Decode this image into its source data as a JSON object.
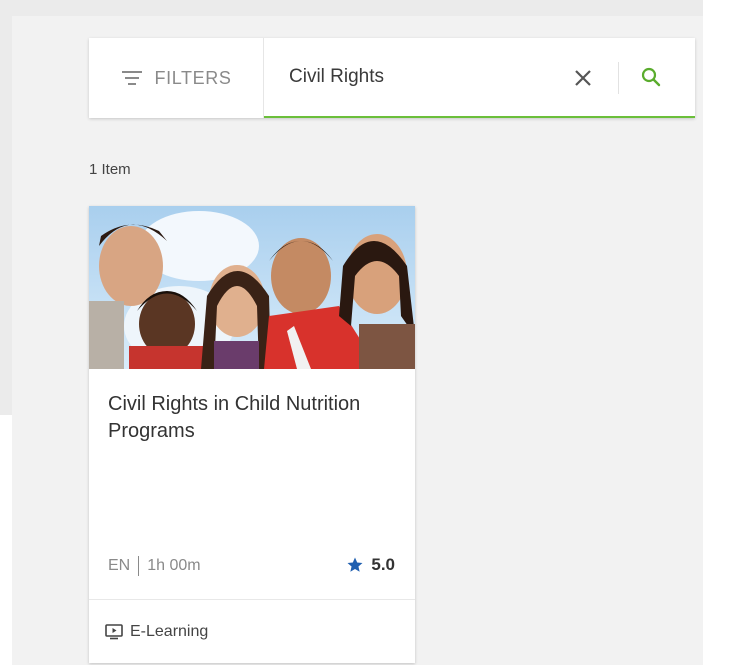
{
  "search": {
    "filters_label": "FILTERS",
    "query": "Civil Rights",
    "accent_color": "#6bbf3a"
  },
  "results": {
    "count_label": "1 Item"
  },
  "card": {
    "title": "Civil Rights in Child Nutrition Programs",
    "language": "EN",
    "duration": "1h 00m",
    "rating": "5.0",
    "rating_color": "#1f5fb0",
    "type": "E-Learning"
  },
  "icons": {
    "filter": "filter-icon",
    "clear": "close-icon",
    "search": "search-icon",
    "star": "star-icon",
    "elearning": "monitor-play-icon"
  }
}
